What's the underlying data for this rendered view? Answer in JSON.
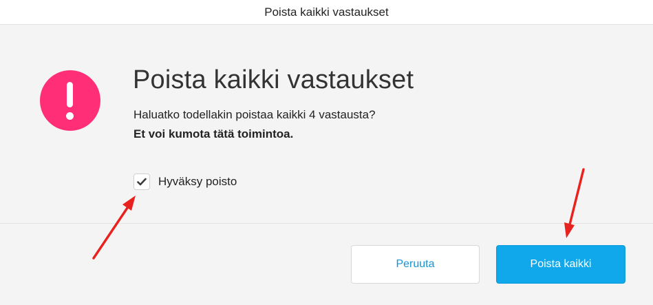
{
  "window": {
    "title": "Poista kaikki vastaukset"
  },
  "dialog": {
    "icon": "exclamation-alert-icon",
    "heading": "Poista kaikki vastaukset",
    "message": "Haluatko todellakin poistaa kaikki 4 vastausta?",
    "warning": "Et voi kumota tätä toimintoa.",
    "confirm_checkbox": {
      "label": "Hyväksy poisto",
      "checked": true
    },
    "buttons": {
      "cancel_label": "Peruuta",
      "delete_label": "Poista kaikki"
    }
  },
  "colors": {
    "alert": "#ff2e77",
    "primary": "#10a8ea",
    "link": "#1593d4",
    "annotation_arrow": "#e8231f"
  }
}
